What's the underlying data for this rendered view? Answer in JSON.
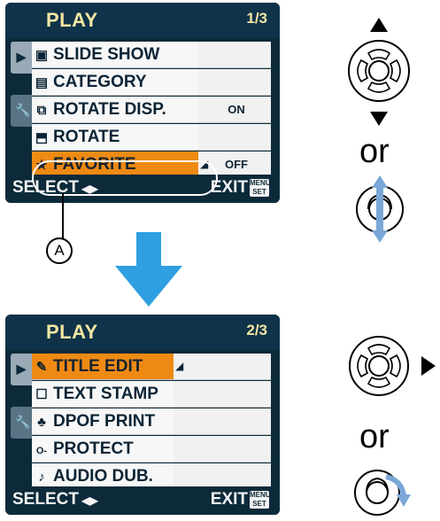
{
  "top_screen": {
    "title": "PLAY",
    "page": "1/3",
    "items": [
      {
        "icon": "slide-show-icon",
        "glyph": "▣",
        "label": "SLIDE SHOW",
        "value": ""
      },
      {
        "icon": "category-icon",
        "glyph": "▤",
        "label": "CATEGORY",
        "value": ""
      },
      {
        "icon": "rotate-disp-icon",
        "glyph": "⧉",
        "label": "ROTATE DISP.",
        "value": "ON"
      },
      {
        "icon": "rotate-icon",
        "glyph": "⬒",
        "label": "ROTATE",
        "value": ""
      },
      {
        "icon": "star-icon",
        "glyph": "★",
        "label": "FAVORITE",
        "value": "OFF",
        "selected": true
      }
    ],
    "footer_select": "SELECT",
    "footer_exit": "EXIT",
    "footer_menu_badge": "MENU SET"
  },
  "bottom_screen": {
    "title": "PLAY",
    "page": "2/3",
    "items": [
      {
        "icon": "title-edit-icon",
        "glyph": "✎",
        "label": "TITLE EDIT",
        "value": "",
        "selected": true
      },
      {
        "icon": "text-stamp-icon",
        "glyph": "☐",
        "label": "TEXT STAMP",
        "value": ""
      },
      {
        "icon": "dpof-print-icon",
        "glyph": "♣",
        "label": "DPOF PRINT",
        "value": ""
      },
      {
        "icon": "protect-icon",
        "glyph": "O-",
        "label": "PROTECT",
        "value": ""
      },
      {
        "icon": "audio-dub-icon",
        "glyph": "♪",
        "label": "AUDIO DUB.",
        "value": ""
      }
    ],
    "footer_select": "SELECT",
    "footer_exit": "EXIT",
    "footer_menu_badge": "MENU SET"
  },
  "callout_marker": "A",
  "or_top": "or",
  "or_bottom": "or",
  "colors": {
    "screen_bg": "#0d2a3a",
    "highlight": "#ee8a14",
    "title_text": "#f3e7a4",
    "arrow_blue": "#2e9fe0"
  }
}
